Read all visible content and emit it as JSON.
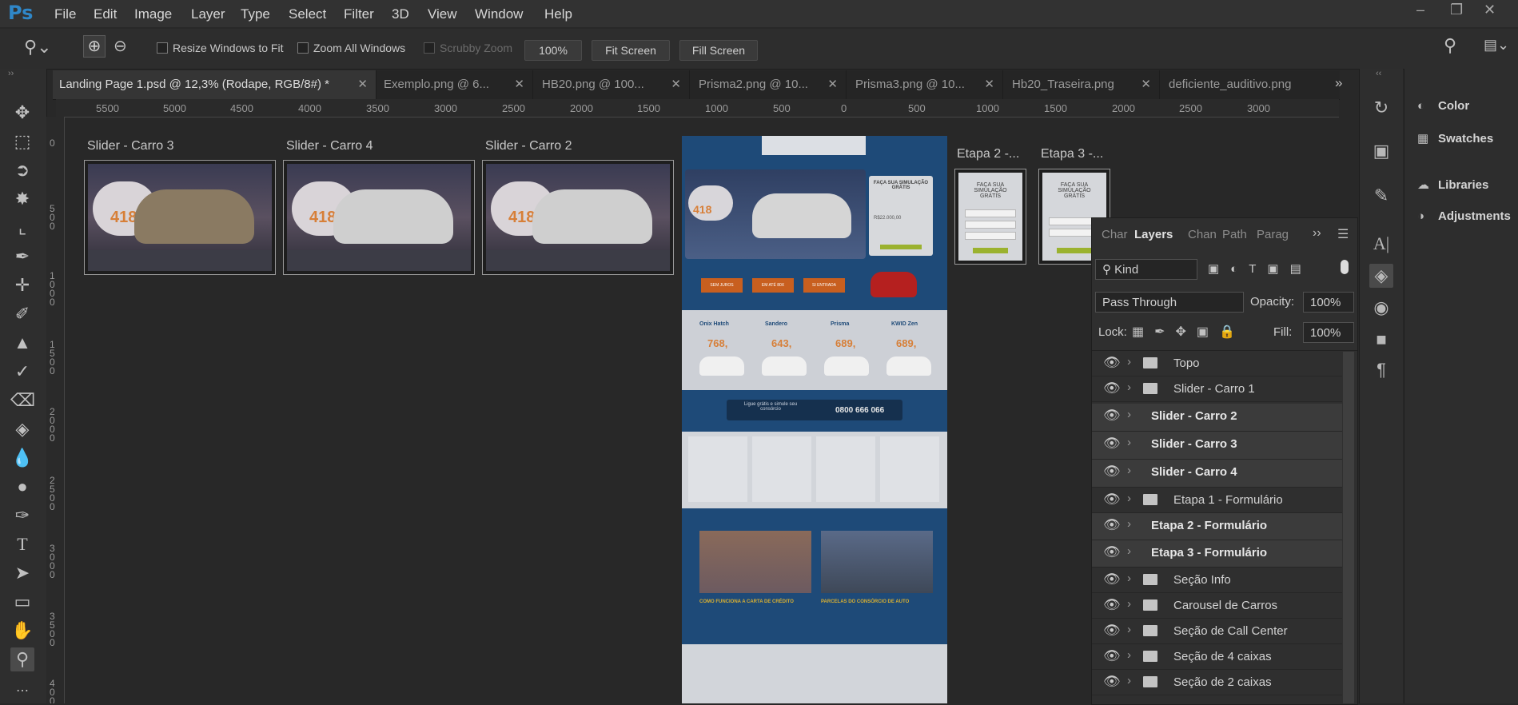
{
  "app": {
    "logo": "Ps"
  },
  "menu": [
    "File",
    "Edit",
    "Image",
    "Layer",
    "Type",
    "Select",
    "Filter",
    "3D",
    "View",
    "Window",
    "Help"
  ],
  "window_controls": [
    "–",
    "❐",
    "✕"
  ],
  "options": {
    "resize_windows": "Resize Windows to Fit",
    "zoom_all": "Zoom All Windows",
    "scrubby_zoom": "Scrubby Zoom",
    "zoom_value": "100%",
    "fit_screen": "Fit Screen",
    "fill_screen": "Fill Screen"
  },
  "tabs": [
    {
      "label": "Landing Page 1.psd @ 12,3% (Rodape, RGB/8#) *"
    },
    {
      "label": "Exemplo.png @ 6..."
    },
    {
      "label": "HB20.png @ 100..."
    },
    {
      "label": "Prisma2.png @ 10..."
    },
    {
      "label": "Prisma3.png @ 10..."
    },
    {
      "label": "Hb20_Traseira.png"
    },
    {
      "label": "deficiente_auditivo.png"
    }
  ],
  "tab_overflow": "»",
  "ruler_h": [
    "5500",
    "5000",
    "4500",
    "4000",
    "3500",
    "3000",
    "2500",
    "2000",
    "1500",
    "1000",
    "500",
    "0",
    "500",
    "1000",
    "1500",
    "2000",
    "2500",
    "3000"
  ],
  "ruler_v": [
    "0",
    "5 0 0",
    "1 0 0 0",
    "1 5 0 0",
    "2 0 0 0",
    "2 5 0 0",
    "3 0 0 0",
    "3 5 0 0",
    "4 0 0 0"
  ],
  "artboards": {
    "slider3": "Slider - Carro 3",
    "slider4": "Slider - Carro 4",
    "slider2": "Slider - Carro 2",
    "etapa2": "Etapa 2 -...",
    "etapa3": "Etapa 3 -..."
  },
  "slide_price": "418",
  "landing": {
    "form_title": "FAÇA SUA SIMULAÇÃO GRÁTIS",
    "form_value": "R$22.000,00",
    "steps": [
      "SEM JUROS",
      "EM ATÉ 80X",
      "SI ENTRADA"
    ],
    "cars": [
      {
        "name": "Onix Hatch",
        "price": "768,"
      },
      {
        "name": "Sandero",
        "price": "643,"
      },
      {
        "name": "Prisma",
        "price": "689,"
      },
      {
        "name": "KWID Zen",
        "price": "689,"
      }
    ],
    "call_text": "Ligue grátis e simule seu consórcio",
    "phone": "0800 666 066",
    "info1": "COMO FUNCIONA A CARTA DE CRÉDITO",
    "info2": "PARCELAS DO CONSÓRCIO DE AUTO"
  },
  "etapa_form_title": "FAÇA SUA SIMULAÇÃO GRÁTIS",
  "right_dock": [
    {
      "icon": "color-icon",
      "label": "Color"
    },
    {
      "icon": "swatches-icon",
      "label": "Swatches"
    },
    {
      "icon": "libraries-icon",
      "label": "Libraries"
    },
    {
      "icon": "adjustments-icon",
      "label": "Adjustments"
    }
  ],
  "layers_panel": {
    "tabs": [
      "Char",
      "Layers",
      "Chan",
      "Path",
      "Parag"
    ],
    "kind": "Kind",
    "blend": "Pass Through",
    "opacity_label": "Opacity:",
    "opacity": "100%",
    "lock_label": "Lock:",
    "fill_label": "Fill:",
    "fill": "100%",
    "layers": [
      {
        "name": "Topo",
        "group": true,
        "highlight": false
      },
      {
        "name": "Slider - Carro 1",
        "group": true,
        "highlight": false
      },
      {
        "name": "Slider - Carro 2",
        "group": false,
        "highlight": true
      },
      {
        "name": "Slider - Carro 3",
        "group": false,
        "highlight": true
      },
      {
        "name": "Slider - Carro 4",
        "group": false,
        "highlight": true
      },
      {
        "name": "Etapa 1 - Formulário",
        "group": true,
        "highlight": false
      },
      {
        "name": "Etapa 2 - Formulário",
        "group": false,
        "highlight": true
      },
      {
        "name": "Etapa 3 - Formulário",
        "group": false,
        "highlight": true
      },
      {
        "name": "Seção Info",
        "group": true,
        "highlight": false
      },
      {
        "name": "Carousel de Carros",
        "group": true,
        "highlight": false
      },
      {
        "name": "Seção de Call Center",
        "group": true,
        "highlight": false
      },
      {
        "name": "Seção de 4 caixas",
        "group": true,
        "highlight": false
      },
      {
        "name": "Seção de 2 caixas",
        "group": true,
        "highlight": false
      }
    ]
  }
}
